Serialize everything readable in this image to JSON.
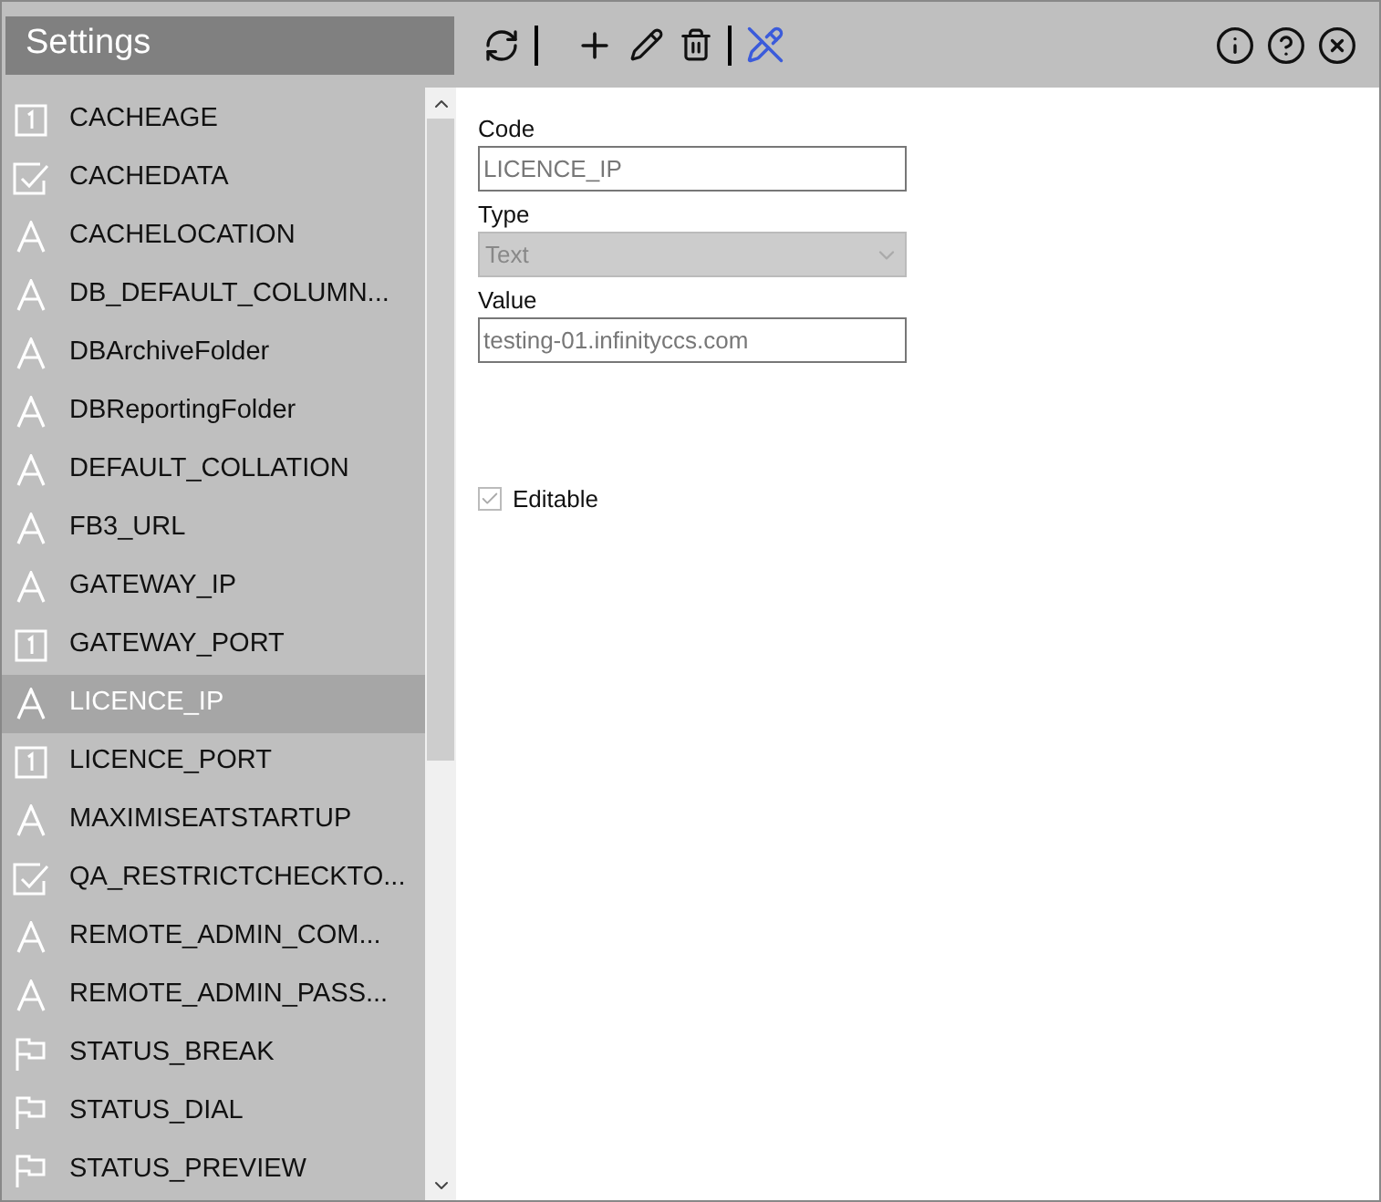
{
  "window": {
    "title": "Settings"
  },
  "items": [
    {
      "label": "CACHEAGE",
      "kind": "number",
      "selected": false
    },
    {
      "label": "CACHEDATA",
      "kind": "bool",
      "selected": false
    },
    {
      "label": "CACHELOCATION",
      "kind": "text",
      "selected": false
    },
    {
      "label": "DB_DEFAULT_COLUMN...",
      "kind": "text",
      "selected": false
    },
    {
      "label": "DBArchiveFolder",
      "kind": "text",
      "selected": false
    },
    {
      "label": "DBReportingFolder",
      "kind": "text",
      "selected": false
    },
    {
      "label": "DEFAULT_COLLATION",
      "kind": "text",
      "selected": false
    },
    {
      "label": "FB3_URL",
      "kind": "text",
      "selected": false
    },
    {
      "label": "GATEWAY_IP",
      "kind": "text",
      "selected": false
    },
    {
      "label": "GATEWAY_PORT",
      "kind": "number",
      "selected": false
    },
    {
      "label": "LICENCE_IP",
      "kind": "text",
      "selected": true
    },
    {
      "label": "LICENCE_PORT",
      "kind": "number",
      "selected": false
    },
    {
      "label": "MAXIMISEATSTARTUP",
      "kind": "text",
      "selected": false
    },
    {
      "label": "QA_RESTRICTCHECKTO...",
      "kind": "bool",
      "selected": false
    },
    {
      "label": "REMOTE_ADMIN_COM...",
      "kind": "text",
      "selected": false
    },
    {
      "label": "REMOTE_ADMIN_PASS...",
      "kind": "text",
      "selected": false
    },
    {
      "label": "STATUS_BREAK",
      "kind": "flag",
      "selected": false
    },
    {
      "label": "STATUS_DIAL",
      "kind": "flag",
      "selected": false
    },
    {
      "label": "STATUS_PREVIEW",
      "kind": "flag",
      "selected": false
    }
  ],
  "form": {
    "code_label": "Code",
    "code_value": "LICENCE_IP",
    "type_label": "Type",
    "type_value": "Text",
    "type_disabled": true,
    "value_label": "Value",
    "value_value": "testing-01.infinityccs.com",
    "editable_label": "Editable",
    "editable_checked": true,
    "editable_disabled": true
  }
}
